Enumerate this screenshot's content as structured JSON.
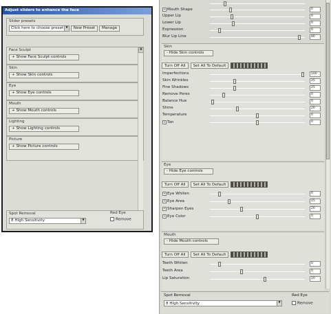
{
  "left_dialog": {
    "title": "Adjust sliders to enhance the face",
    "presets": {
      "label": "Slider presets",
      "value": "Click here to choose preset",
      "new_label": "New Preset",
      "manage_label": "Manage"
    },
    "groups": [
      {
        "label": "Face Sculpt",
        "button": "+ Show Face Sculpt controls"
      },
      {
        "label": "Skin",
        "button": "+ Show Skin controls"
      },
      {
        "label": "Eye",
        "button": "+ Show Eye controls"
      },
      {
        "label": "Mouth",
        "button": "+ Show Mouth controls"
      },
      {
        "label": "Lighting",
        "button": "+ Show Lighting controls"
      },
      {
        "label": "Picture",
        "button": "+ Show Picture controls"
      }
    ],
    "spot_removal": {
      "label": "Spot Removal",
      "value": "8 High Sensitivity"
    },
    "red_eye": {
      "label": "Red Eye",
      "checkbox_label": "Remove"
    }
  },
  "right_panel": {
    "top_rows": [
      {
        "name": "Mouth Shape",
        "expand": "+",
        "value": "0"
      },
      {
        "name": "Upper Lip",
        "value": "0"
      },
      {
        "name": "Lower Lip",
        "value": "0"
      },
      {
        "name": "Expression",
        "value": "0"
      },
      {
        "name": "Blur Lip Line",
        "value": "80"
      }
    ],
    "skin": {
      "title": "Skin",
      "hide_label": "- Hide Skin controls",
      "turn_off_label": "Turn Off All",
      "reset_label": "Set All To Default",
      "rows": [
        {
          "name": "Imperfections",
          "value": "100"
        },
        {
          "name": "Skin Wrinkles",
          "value": "25"
        },
        {
          "name": "Fine Shadows",
          "value": "25"
        },
        {
          "name": "Remove Pores",
          "value": "0"
        },
        {
          "name": "Balance Hue",
          "value": "0"
        },
        {
          "name": "Shine",
          "value": "20"
        },
        {
          "name": "Temperature",
          "value": "0"
        },
        {
          "name": "Tan",
          "expand": "+",
          "value": "0"
        }
      ]
    },
    "eye": {
      "title": "Eye",
      "hide_label": "- Hide Eye controls",
      "turn_off_label": "Turn Off All",
      "reset_label": "Set All To Default",
      "rows": [
        {
          "name": "Eye Whiten",
          "expand": "+",
          "value": "0"
        },
        {
          "name": "Eye Area",
          "expand": "+",
          "value": "15"
        },
        {
          "name": "Sharpen Eyes",
          "expand": "+",
          "value": "20"
        },
        {
          "name": "Eye Color",
          "expand": "+",
          "value": "0"
        }
      ]
    },
    "mouth": {
      "title": "Mouth",
      "hide_label": "- Hide Mouth controls",
      "turn_off_label": "Turn Off All",
      "reset_label": "Set All To Default",
      "rows": [
        {
          "name": "Teeth Whiten",
          "value": "0"
        },
        {
          "name": "Teeth Area",
          "value": "0"
        },
        {
          "name": "Lip Saturation",
          "value": "10"
        }
      ]
    },
    "spot_removal": {
      "label": "Spot Removal",
      "value": "8 High Sensitivity"
    },
    "red_eye": {
      "label": "Red Eye",
      "checkbox_label": "Remove"
    }
  }
}
